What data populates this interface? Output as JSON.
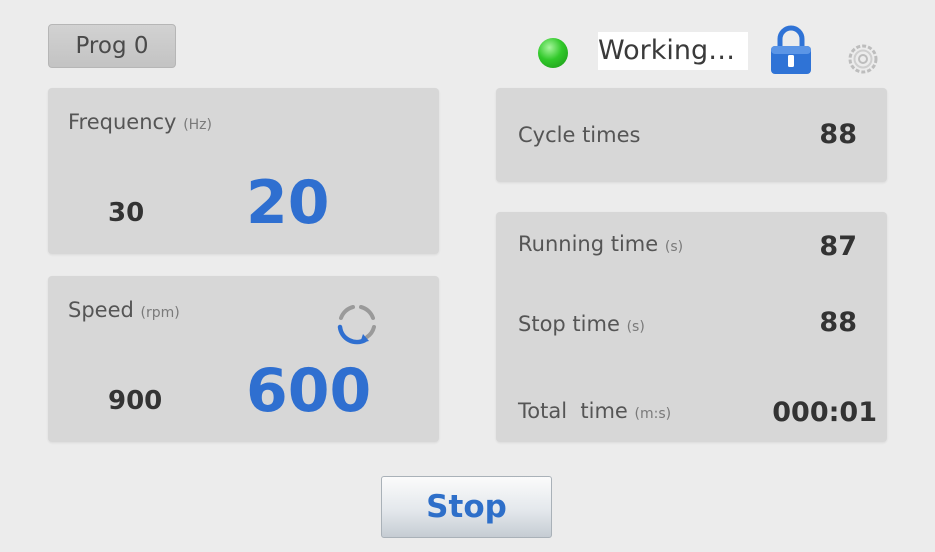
{
  "header": {
    "program_label": "Prog 0",
    "status_text": "Working…",
    "status_color": "#31c92a",
    "lock_icon": "lock-icon",
    "settings_icon": "gear-icon"
  },
  "frequency": {
    "label": "Frequency",
    "unit": "(Hz)",
    "setpoint": "30",
    "actual": "20"
  },
  "speed": {
    "label": "Speed",
    "unit": "(rpm)",
    "setpoint": "900",
    "actual": "600",
    "rotation_icon": "rotate-icon"
  },
  "cycle": {
    "label": "Cycle times",
    "value": "88"
  },
  "times": {
    "running_label": "Running time",
    "running_unit": "(s)",
    "running_value": "87",
    "stop_label": "Stop time",
    "stop_unit": "(s)",
    "stop_value": "88",
    "total_label": "Total  time",
    "total_unit": "(m:s)",
    "total_value": "000:01"
  },
  "controls": {
    "stop_label": "Stop"
  },
  "colors": {
    "accent": "#2f6fd0",
    "background": "#ececec",
    "panel": "#d7d7d7"
  }
}
